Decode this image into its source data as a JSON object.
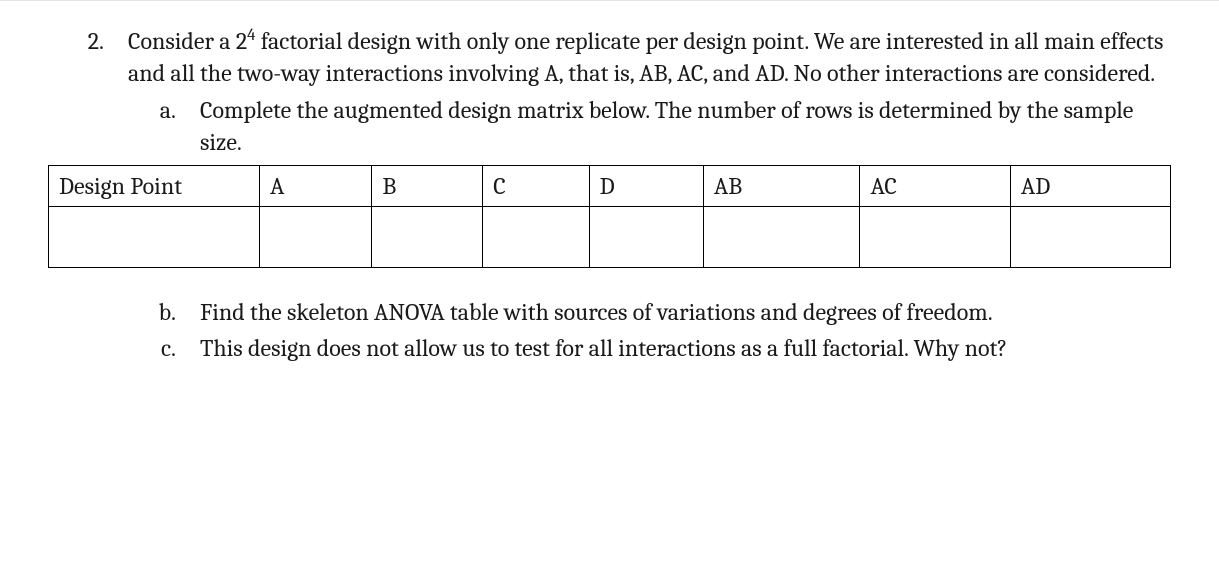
{
  "question": {
    "number": "2.",
    "text_prefix": "Consider a 2",
    "exponent": "4",
    "text_suffix": " factorial design with only one replicate per design point. We are interested in all main effects and all the two-way interactions involving A, that is, AB, AC, and AD. No other interactions are considered."
  },
  "parts": {
    "a": {
      "marker": "a.",
      "text": "Complete the augmented design matrix below. The number of rows is determined by the sample size."
    },
    "b": {
      "marker": "b.",
      "text": "Find the skeleton ANOVA table with sources of variations and degrees of freedom."
    },
    "c": {
      "marker": "c.",
      "text": "This design does not allow us to test for all interactions as a full factorial. Why not?"
    }
  },
  "table": {
    "headers": [
      "Design Point",
      "A",
      "B",
      "C",
      "D",
      "AB",
      "AC",
      "AD"
    ]
  }
}
